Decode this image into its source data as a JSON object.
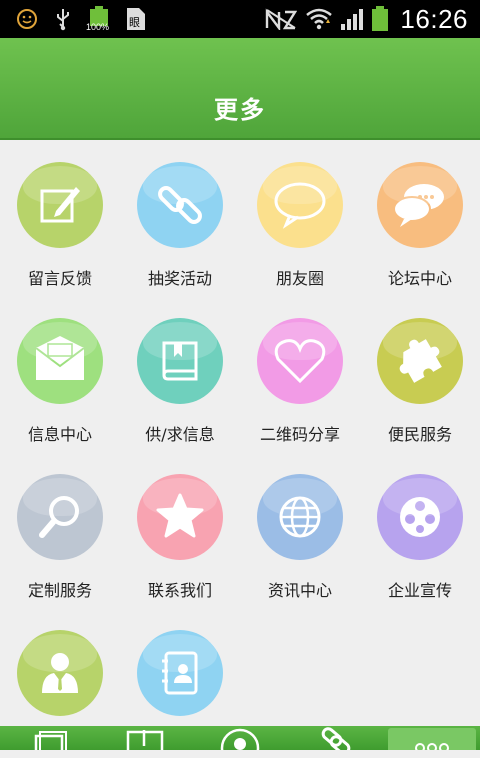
{
  "status_bar": {
    "time": "16:26",
    "battery_label": "100%"
  },
  "header": {
    "title": "更多"
  },
  "grid": {
    "items": [
      {
        "label": "留言反馈",
        "icon": "edit-icon",
        "color": "#b7d36a"
      },
      {
        "label": "抽奖活动",
        "icon": "link-icon",
        "color": "#8fd3f2"
      },
      {
        "label": "朋友圈",
        "icon": "speech-bubble-icon",
        "color": "#fbe08d"
      },
      {
        "label": "论坛中心",
        "icon": "chat-icon",
        "color": "#f8bd7f"
      },
      {
        "label": "信息中心",
        "icon": "mail-icon",
        "color": "#9ee07f"
      },
      {
        "label": "供/求信息",
        "icon": "book-icon",
        "color": "#6fd0bd"
      },
      {
        "label": "二维码分享",
        "icon": "heart-icon",
        "color": "#f29be6"
      },
      {
        "label": "便民服务",
        "icon": "puzzle-icon",
        "color": "#c8cc52"
      },
      {
        "label": "定制服务",
        "icon": "magnifier-icon",
        "color": "#bdc6d2"
      },
      {
        "label": "联系我们",
        "icon": "star-icon",
        "color": "#f8a3b1"
      },
      {
        "label": "资讯中心",
        "icon": "globe-icon",
        "color": "#9bbde6"
      },
      {
        "label": "企业宣传",
        "icon": "film-reel-icon",
        "color": "#b7a3ee"
      },
      {
        "label": "",
        "icon": "user-icon",
        "color": "#b7d36a"
      },
      {
        "label": "",
        "icon": "contacts-icon",
        "color": "#8fd3f2"
      }
    ]
  },
  "bottom_bar": {
    "tabs": [
      {
        "icon": "window-icon"
      },
      {
        "icon": "download-icon"
      },
      {
        "icon": "person-icon"
      },
      {
        "icon": "link-icon"
      },
      {
        "icon": "more-icon"
      }
    ]
  }
}
